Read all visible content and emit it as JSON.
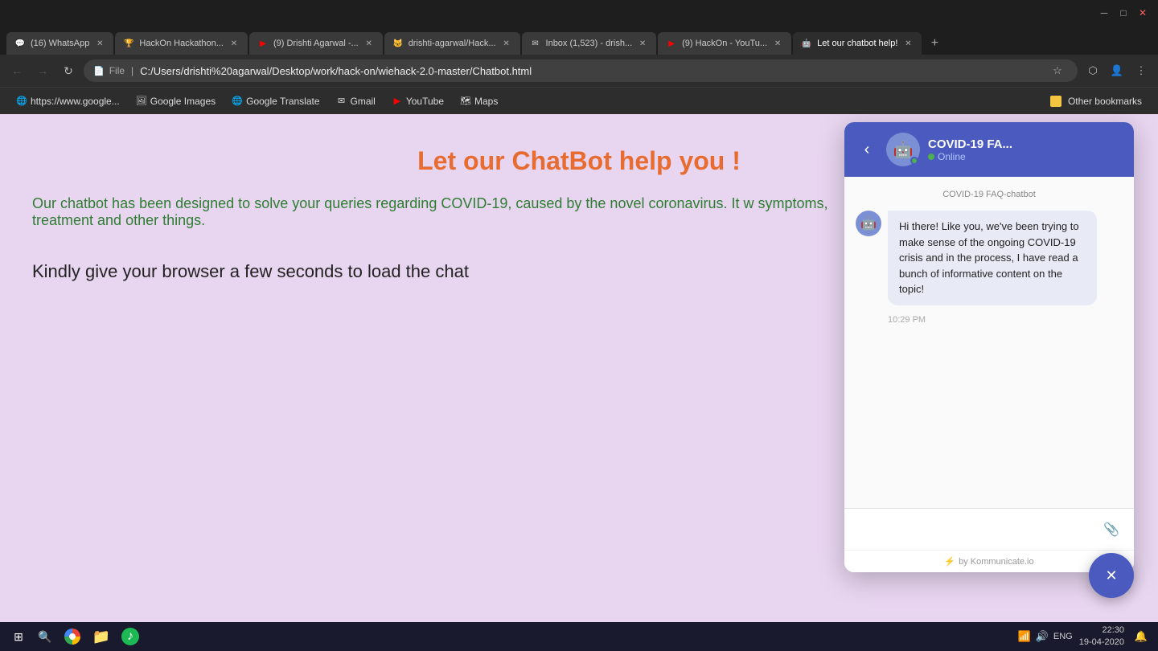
{
  "browser": {
    "tabs": [
      {
        "id": 1,
        "label": "(16) WhatsApp",
        "favicon": "💬",
        "active": false
      },
      {
        "id": 2,
        "label": "HackOn Hackathon...",
        "favicon": "🏆",
        "active": false
      },
      {
        "id": 3,
        "label": "(9) Drishti Agarwal -...",
        "favicon": "▶",
        "active": false
      },
      {
        "id": 4,
        "label": "drishti-agarwal/Hack...",
        "favicon": "🐱",
        "active": false
      },
      {
        "id": 5,
        "label": "Inbox (1,523) - drish...",
        "favicon": "✉",
        "active": false
      },
      {
        "id": 6,
        "label": "(9) HackOn - YouTu...",
        "favicon": "▶",
        "active": false
      },
      {
        "id": 7,
        "label": "Let our chatbot help!",
        "favicon": "🤖",
        "active": true
      }
    ],
    "address_bar": {
      "protocol": "File",
      "url": "C:/Users/drishti%20agarwal/Desktop/work/hack-on/wiehack-2.0-master/Chatbot.html"
    },
    "bookmarks": [
      {
        "id": 1,
        "label": "https://www.google...",
        "favicon": "🌐"
      },
      {
        "id": 2,
        "label": "Google Images",
        "favicon": "🖼"
      },
      {
        "id": 3,
        "label": "Google Translate",
        "favicon": "🌐"
      },
      {
        "id": 4,
        "label": "Gmail",
        "favicon": "✉"
      },
      {
        "id": 5,
        "label": "YouTube",
        "favicon": "▶"
      },
      {
        "id": 6,
        "label": "Maps",
        "favicon": "🗺"
      }
    ],
    "other_bookmarks": "Other bookmarks"
  },
  "page": {
    "title": "Let our ChatBot help you !",
    "description": "Our chatbot has been designed to solve your queries regarding COVID-19, caused by the novel coronavirus. It w symptoms, treatment and other things.",
    "loading_text": "Kindly give your browser a few seconds to load the chat"
  },
  "chatbot": {
    "header_title": "COVID-19 FA...",
    "status": "Online",
    "source_label": "COVID-19 FAQ-chatbot",
    "message": "Hi there!  Like you, we've been trying to make sense of the ongoing COVID-19 crisis and in the process, I have read a bunch of informative content on the topic!",
    "timestamp": "10:29 PM",
    "input_placeholder": "",
    "footer_text": "by Kommunicate.io",
    "back_icon": "‹",
    "attach_icon": "📎",
    "bot_emoji": "🤖",
    "close_icon": "✕",
    "lightning_icon": "⚡"
  },
  "taskbar": {
    "time": "22:30",
    "date": "19-04-2020",
    "start_icon": "⊞",
    "search_icon": "🔍",
    "lang": "ENG"
  }
}
